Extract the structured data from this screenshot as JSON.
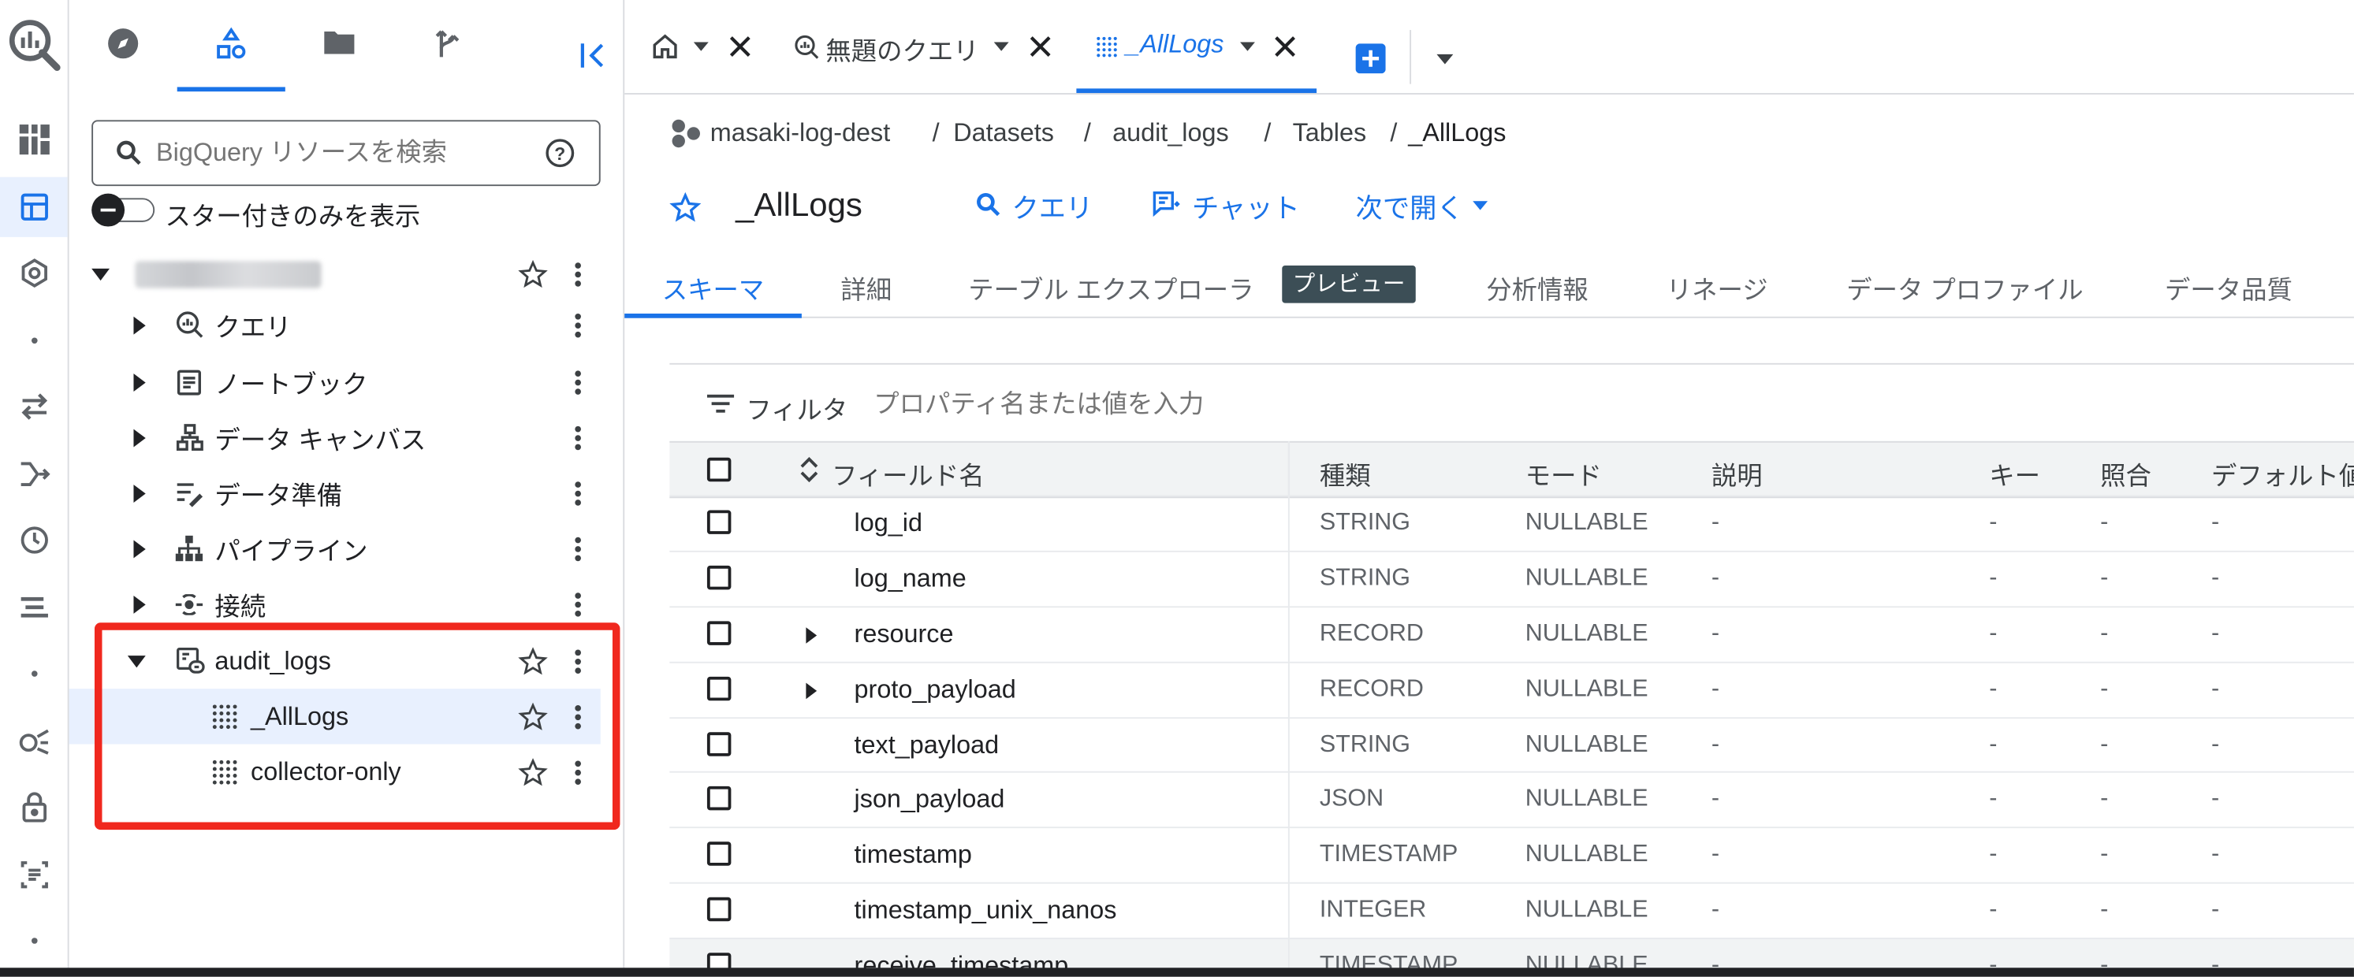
{
  "colors": {
    "accent": "#1a73e8",
    "highlight_box": "#f0281e",
    "badge_bg": "#3c4e56"
  },
  "rail": {
    "icons": [
      "bigquery-logo-icon",
      "dashboard-icon",
      "studio-icon",
      "hexagon-icon",
      "dot-icon",
      "transfers-icon",
      "pipelines-icon",
      "scheduled-icon",
      "jobs-icon",
      "dot-icon",
      "analytics-hub-icon",
      "lock-icon",
      "reservations-icon",
      "dot-icon"
    ]
  },
  "explorer": {
    "search_placeholder": "BigQuery リソースを検索",
    "starred_toggle_label": "スター付きのみを表示",
    "project_name_blurred": "masaki-log-dest",
    "items": [
      {
        "label": "クエリ",
        "icon": "query-icon"
      },
      {
        "label": "ノートブック",
        "icon": "notebook-icon"
      },
      {
        "label": "データ キャンバス",
        "icon": "canvas-icon"
      },
      {
        "label": "データ準備",
        "icon": "data-prep-icon"
      },
      {
        "label": "パイプライン",
        "icon": "pipeline-icon"
      },
      {
        "label": "接続",
        "icon": "connection-icon"
      }
    ],
    "dataset": {
      "label": "audit_logs",
      "tables": [
        {
          "label": "_AllLogs"
        },
        {
          "label": "collector-only"
        }
      ]
    }
  },
  "tabs": {
    "home_icon": "home-icon",
    "query_tab": "無題のクエリ",
    "table_tab": "_AllLogs"
  },
  "breadcrumb": {
    "project": "masaki-log-dest",
    "sep": "/",
    "datasets": "Datasets",
    "dataset": "audit_logs",
    "tables": "Tables",
    "table": "_AllLogs"
  },
  "header": {
    "title": "_AllLogs",
    "query": "クエリ",
    "chat": "チャット",
    "open_with": "次で開く"
  },
  "subtabs": {
    "schema": "スキーマ",
    "details": "詳細",
    "explorer": "テーブル エクスプローラ",
    "preview_badge": "プレビュー",
    "insights": "分析情報",
    "lineage": "リネージ",
    "profile": "データ プロファイル",
    "quality": "データ品質"
  },
  "filter": {
    "label": "フィルタ",
    "placeholder": "プロパティ名または値を入力"
  },
  "schema_table": {
    "headers": {
      "field": "フィールド名",
      "type": "種類",
      "mode": "モード",
      "desc": "説明",
      "key": "キー",
      "collation": "照合",
      "default": "デフォルト値"
    },
    "rows": [
      {
        "name": "log_id",
        "type": "STRING",
        "mode": "NULLABLE",
        "desc": "-",
        "key": "-",
        "collation": "-",
        "default": "-",
        "expandable": false
      },
      {
        "name": "log_name",
        "type": "STRING",
        "mode": "NULLABLE",
        "desc": "-",
        "key": "-",
        "collation": "-",
        "default": "-",
        "expandable": false
      },
      {
        "name": "resource",
        "type": "RECORD",
        "mode": "NULLABLE",
        "desc": "-",
        "key": "-",
        "collation": "-",
        "default": "-",
        "expandable": true
      },
      {
        "name": "proto_payload",
        "type": "RECORD",
        "mode": "NULLABLE",
        "desc": "-",
        "key": "-",
        "collation": "-",
        "default": "-",
        "expandable": true
      },
      {
        "name": "text_payload",
        "type": "STRING",
        "mode": "NULLABLE",
        "desc": "-",
        "key": "-",
        "collation": "-",
        "default": "-",
        "expandable": false
      },
      {
        "name": "json_payload",
        "type": "JSON",
        "mode": "NULLABLE",
        "desc": "-",
        "key": "-",
        "collation": "-",
        "default": "-",
        "expandable": false
      },
      {
        "name": "timestamp",
        "type": "TIMESTAMP",
        "mode": "NULLABLE",
        "desc": "-",
        "key": "-",
        "collation": "-",
        "default": "-",
        "expandable": false
      },
      {
        "name": "timestamp_unix_nanos",
        "type": "INTEGER",
        "mode": "NULLABLE",
        "desc": "-",
        "key": "-",
        "collation": "-",
        "default": "-",
        "expandable": false
      },
      {
        "name": "receive_timestamp",
        "type": "TIMESTAMP",
        "mode": "NULLABLE",
        "desc": "-",
        "key": "-",
        "collation": "-",
        "default": "-",
        "expandable": false
      }
    ]
  }
}
